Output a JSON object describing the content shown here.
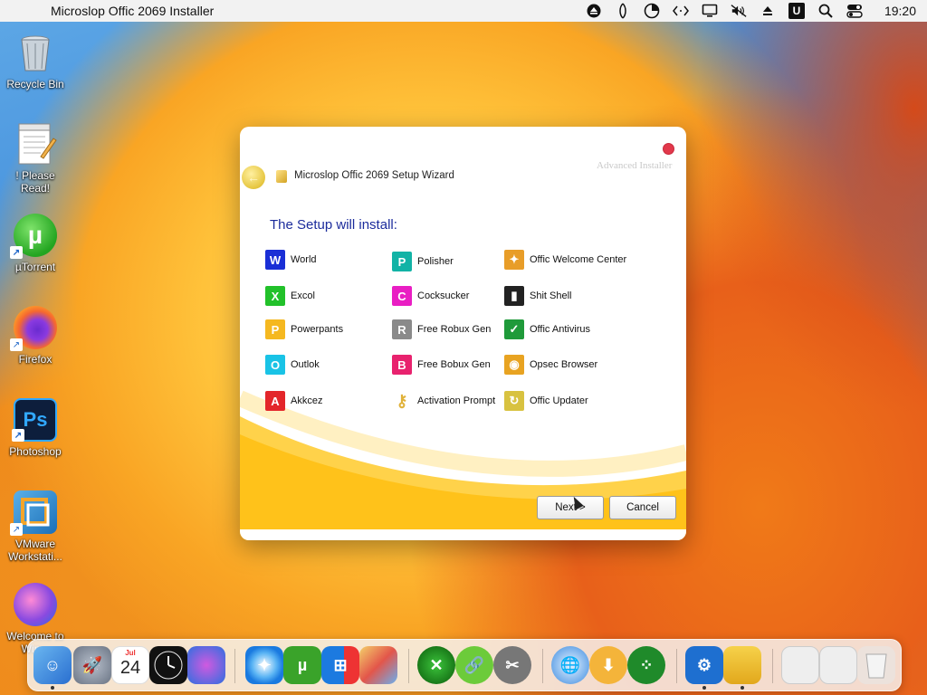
{
  "menubar": {
    "app_title": "Microslop Offic 2069 Installer",
    "clock": "19:20",
    "tray_icons": [
      "eject-icon",
      "tor-icon",
      "timer-icon",
      "code-icon",
      "display-icon",
      "mute-icon",
      "eject-triangle-icon",
      "u-icon",
      "search-icon",
      "control-center-icon"
    ],
    "u_badge": "U"
  },
  "desktop": {
    "icons": [
      {
        "label": "Recycle Bin",
        "icon": "recycle-bin-icon"
      },
      {
        "label": "! Please Read!",
        "icon": "notepad-icon"
      },
      {
        "label": "µTorrent",
        "icon": "utorrent-icon"
      },
      {
        "label": "Firefox",
        "icon": "firefox-icon"
      },
      {
        "label": "Photoshop",
        "icon": "photoshop-icon"
      },
      {
        "label": "VMware Workstati...",
        "icon": "vmware-icon"
      },
      {
        "label": "Welcome to Win...",
        "icon": "apple-icon"
      }
    ],
    "utorrent_glyph": "µ",
    "photoshop_glyph": "Ps"
  },
  "installer": {
    "brand": "Advanced Installer",
    "wizard_title": "Microslop Offic 2069 Setup Wizard",
    "heading": "The Setup will install:",
    "columns": [
      [
        {
          "label": "World",
          "icon": "word-icon",
          "color": "#1a2fd6"
        },
        {
          "label": "Excol",
          "icon": "excel-icon",
          "color": "#22c12a"
        },
        {
          "label": "Powerpants",
          "icon": "powerpoint-icon",
          "color": "#f5b820"
        },
        {
          "label": "Outlok",
          "icon": "outlook-icon",
          "color": "#19c3e6"
        },
        {
          "label": "Akkcez",
          "icon": "access-icon",
          "color": "#e3262a"
        }
      ],
      [
        {
          "label": "Polisher",
          "icon": "publisher-icon",
          "color": "#12b3a6"
        },
        {
          "label": "Cocksucker",
          "icon": "cocksucker-icon",
          "color": "#e91ec3"
        },
        {
          "label": "Free Robux Gen",
          "icon": "robux-icon",
          "color": "#8a8a8a"
        },
        {
          "label": "Free Bobux Gen",
          "icon": "bobux-icon",
          "color": "#e8226e"
        },
        {
          "label": "Activation Prompt",
          "icon": "key-icon",
          "color": "#e0b23a"
        }
      ],
      [
        {
          "label": "Offic Welcome Center",
          "icon": "welcome-center-icon",
          "color": "#e89d28"
        },
        {
          "label": "Shit Shell",
          "icon": "shell-icon",
          "color": "#222222"
        },
        {
          "label": "Offic Antivirus",
          "icon": "antivirus-icon",
          "color": "#1f9a3a"
        },
        {
          "label": "Opsec Browser",
          "icon": "browser-icon",
          "color": "#e8a321"
        },
        {
          "label": "Offic Updater",
          "icon": "updater-icon",
          "color": "#d8c240"
        }
      ]
    ],
    "next_label": "Next >",
    "cancel_label": "Cancel"
  },
  "dock": {
    "calendar_month": "Jul",
    "calendar_day": "24",
    "apps": [
      "finder-icon",
      "launchpad-icon",
      "calendar-icon",
      "clock-icon",
      "apple-icon",
      "safari-icon",
      "utorrent-icon",
      "windows-icon",
      "photos-icon",
      "xbox-icon",
      "link-icon",
      "tools-icon",
      "www-icon",
      "download-icon",
      "network-icon",
      "settings-icon",
      "notes-icon",
      "window-1-icon",
      "window-2-icon",
      "trash-icon"
    ]
  }
}
